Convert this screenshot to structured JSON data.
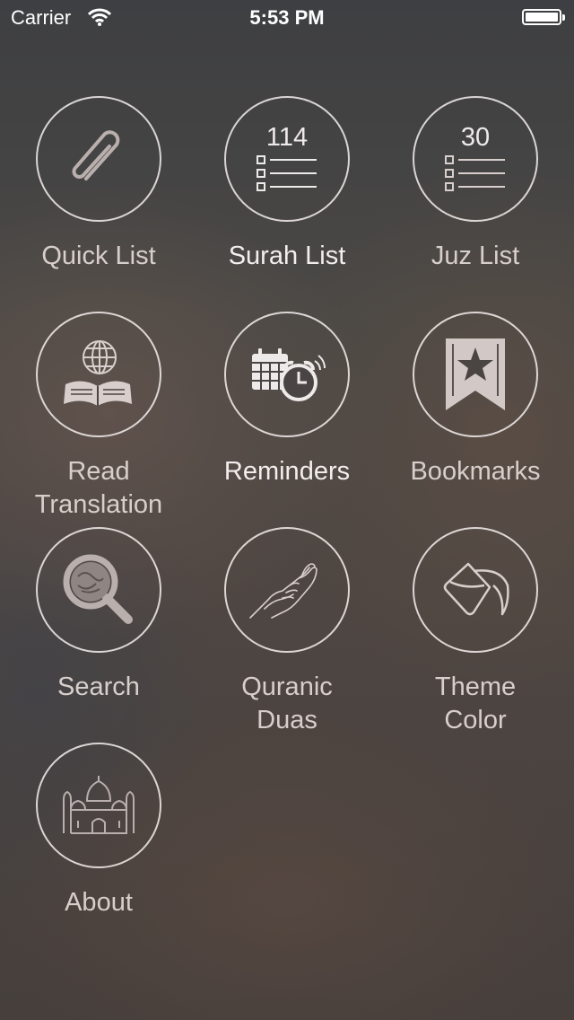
{
  "status_bar": {
    "carrier": "Carrier",
    "time": "5:53 PM",
    "battery_level": 1.0
  },
  "menu": [
    {
      "key": "quick-list",
      "label": "Quick List",
      "icon": "paperclip-icon"
    },
    {
      "key": "surah-list",
      "label": "Surah List",
      "icon": "list-icon",
      "count": "114"
    },
    {
      "key": "juz-list",
      "label": "Juz List",
      "icon": "list-icon",
      "count": "30"
    },
    {
      "key": "read-translation",
      "label": "Read\nTranslation",
      "icon": "globe-book-icon"
    },
    {
      "key": "reminders",
      "label": "Reminders",
      "icon": "calendar-alarm-icon"
    },
    {
      "key": "bookmarks",
      "label": "Bookmarks",
      "icon": "bookmark-star-icon"
    },
    {
      "key": "search",
      "label": "Search",
      "icon": "magnifier-icon"
    },
    {
      "key": "quranic-duas",
      "label": "Quranic\nDuas",
      "icon": "praying-hands-icon"
    },
    {
      "key": "theme-color",
      "label": "Theme\nColor",
      "icon": "paint-bucket-icon"
    },
    {
      "key": "about",
      "label": "About",
      "icon": "mosque-icon"
    }
  ]
}
